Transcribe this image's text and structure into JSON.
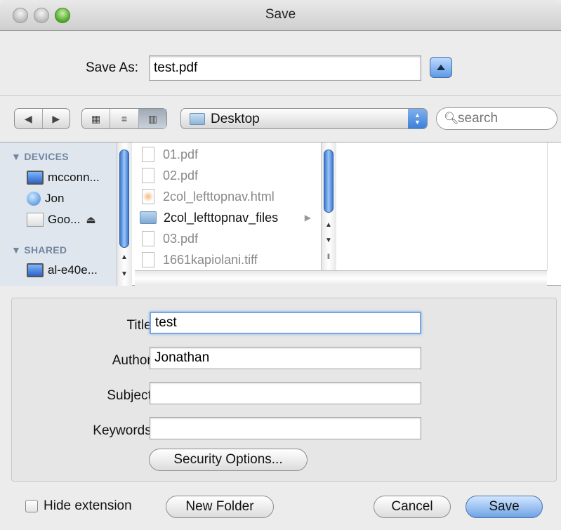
{
  "window": {
    "title": "Save"
  },
  "save_as": {
    "label": "Save As:",
    "value": "test.pdf"
  },
  "toolbar": {
    "location": "Desktop",
    "search_placeholder": "search"
  },
  "sidebar": {
    "devices_heading": "DEVICES",
    "devices": [
      {
        "label": "mcconn...",
        "icon": "monitor-icon"
      },
      {
        "label": "Jon",
        "icon": "globe-icon"
      },
      {
        "label": "Goo...",
        "icon": "disk-icon"
      }
    ],
    "shared_heading": "SHARED",
    "shared": [
      {
        "label": "al-e40e...",
        "icon": "monitor-icon"
      }
    ]
  },
  "files": [
    {
      "name": "01.pdf",
      "type": "pdf",
      "dim": true
    },
    {
      "name": "02.pdf",
      "type": "pdf",
      "dim": true
    },
    {
      "name": "2col_lefttopnav.html",
      "type": "html",
      "dim": true
    },
    {
      "name": "2col_lefttopnav_files",
      "type": "folder",
      "dim": false
    },
    {
      "name": "03.pdf",
      "type": "pdf",
      "dim": true
    },
    {
      "name": "1661kapiolani.tiff",
      "type": "tiff",
      "dim": true
    }
  ],
  "pdf_options": {
    "title_label": "Title:",
    "title_value": "test",
    "author_label": "Author:",
    "author_value": "Jonathan",
    "subject_label": "Subject:",
    "subject_value": "",
    "keywords_label": "Keywords:",
    "keywords_value": "",
    "security_button": "Security Options..."
  },
  "footer": {
    "hide_extension": "Hide extension",
    "new_folder": "New Folder",
    "cancel": "Cancel",
    "save": "Save"
  },
  "colors": {
    "accent": "#5e98e6",
    "sidebar_bg": "#dfe6ee"
  }
}
